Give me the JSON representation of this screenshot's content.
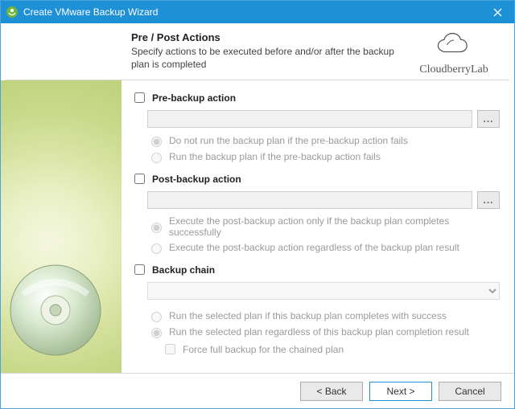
{
  "window": {
    "title": "Create VMware Backup Wizard"
  },
  "header": {
    "title": "Pre / Post Actions",
    "subtitle": "Specify actions to be executed before and/or after the backup plan is completed"
  },
  "brand": {
    "name": "CloudberryLab"
  },
  "pre": {
    "section_label": "Pre-backup action",
    "checked": false,
    "path": "",
    "browse_label": "...",
    "opt_no_run": "Do not run the backup plan if the pre-backup action fails",
    "opt_run": "Run the backup plan if the pre-backup action fails"
  },
  "post": {
    "section_label": "Post-backup action",
    "checked": false,
    "path": "",
    "browse_label": "...",
    "opt_success_only": "Execute the post-backup action only if the backup plan completes successfully",
    "opt_always": "Execute the post-backup action regardless of the backup plan result"
  },
  "chain": {
    "section_label": "Backup chain",
    "checked": false,
    "selected": "",
    "opt_success": "Run the selected plan if this backup plan completes with success",
    "opt_always": "Run the selected plan regardless of this backup plan completion result",
    "force_full": "Force full backup for the chained plan"
  },
  "footer": {
    "back": "< Back",
    "next": "Next >",
    "cancel": "Cancel"
  }
}
